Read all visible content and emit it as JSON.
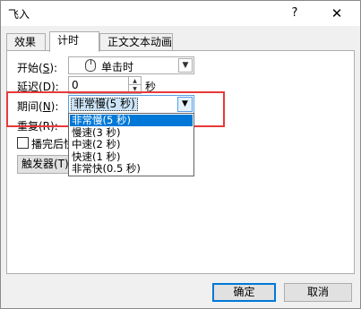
{
  "window": {
    "title": "飞入",
    "help_glyph": "?",
    "close_glyph": "✕"
  },
  "tabs": [
    {
      "label": "效果"
    },
    {
      "label": "计时"
    },
    {
      "label": "正文文本动画"
    }
  ],
  "timing": {
    "start": {
      "label_prefix": "开始(",
      "label_key": "S",
      "label_suffix": "):",
      "value": "单击时",
      "icon": "mouse-icon"
    },
    "delay": {
      "label_prefix": "延迟(",
      "label_key": "D",
      "label_suffix": "):",
      "value": "0",
      "unit": "秒"
    },
    "duration": {
      "label_prefix": "期间(",
      "label_key": "N",
      "label_suffix": "):",
      "value": "非常慢(5 秒)",
      "options": [
        "非常慢(5 秒)",
        "慢速(3 秒)",
        "中速(2 秒)",
        "快速(1 秒)",
        "非常快(0.5 秒)"
      ],
      "highlighted_index": 0
    },
    "repeat": {
      "label_visible": "重复(R):"
    },
    "rewind": {
      "label_visible": "播完后快"
    },
    "trigger": {
      "label_visible": "触发器(T)"
    }
  },
  "buttons": {
    "ok": "确定",
    "cancel": "取消"
  },
  "colors": {
    "highlight_box": "#e8393a",
    "selection": "#0078d7"
  }
}
